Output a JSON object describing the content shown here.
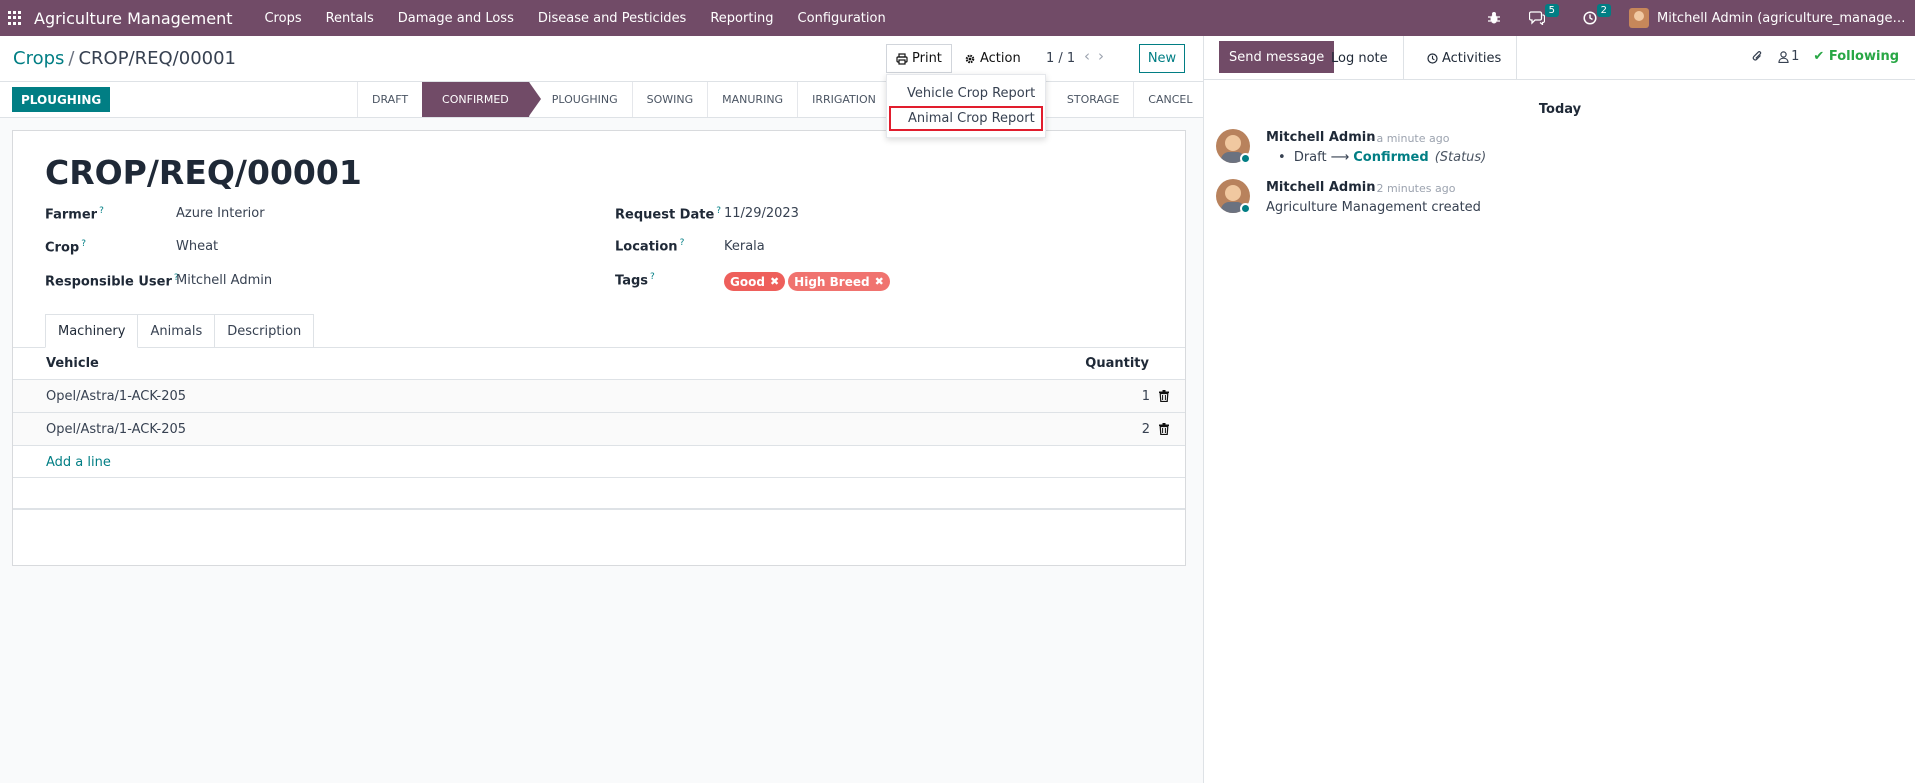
{
  "navbar": {
    "app_title": "Agriculture Management",
    "menu": [
      "Crops",
      "Rentals",
      "Damage and Loss",
      "Disease and Pesticides",
      "Reporting",
      "Configuration"
    ],
    "messages_count": "5",
    "activities_count": "2",
    "user": "Mitchell Admin (agriculture_management)"
  },
  "breadcrumb": {
    "parent": "Crops",
    "separator": "/",
    "current": "CROP/REQ/00001"
  },
  "control": {
    "print_label": "Print",
    "action_label": "Action",
    "pager": "1 / 1",
    "new_label": "New"
  },
  "print_menu": {
    "items": [
      "Vehicle Crop Report",
      "Animal Crop Report"
    ]
  },
  "status": {
    "action_button": "PLOUGHING",
    "stages": [
      "DRAFT",
      "CONFIRMED",
      "PLOUGHING",
      "SOWING",
      "MANURING",
      "IRRIGATION",
      "STORAGE",
      "CANCEL"
    ],
    "active_stage": "CONFIRMED"
  },
  "form": {
    "title": "CROP/REQ/00001",
    "farmer_label": "Farmer",
    "farmer": "Azure Interior",
    "crop_label": "Crop",
    "crop": "Wheat",
    "user_label": "Responsible User",
    "user": "Mitchell Admin",
    "request_date_label": "Request Date",
    "request_date": "11/29/2023",
    "location_label": "Location",
    "location": "Kerala",
    "tags_label": "Tags",
    "tags": [
      {
        "label": "Good",
        "color": "#ee5f5b"
      },
      {
        "label": "High Breed",
        "color": "#f0736f"
      }
    ],
    "help_mark": "?"
  },
  "tabs": [
    "Machinery",
    "Animals",
    "Description"
  ],
  "table": {
    "headers": {
      "vehicle": "Vehicle",
      "quantity": "Quantity"
    },
    "rows": [
      {
        "vehicle": "Opel/Astra/1-ACK-205",
        "quantity": "1"
      },
      {
        "vehicle": "Opel/Astra/1-ACK-205",
        "quantity": "2"
      }
    ],
    "add_line": "Add a line"
  },
  "chatter": {
    "send_message": "Send message",
    "log_note": "Log note",
    "activities": "Activities",
    "followers_count": "1",
    "following": "Following",
    "today": "Today",
    "messages": [
      {
        "author": "Mitchell Admin",
        "time": "- a minute ago",
        "old": "Draft",
        "new": "Confirmed",
        "field": "(Status)"
      },
      {
        "author": "Mitchell Admin",
        "time": "- 2 minutes ago",
        "body": "Agriculture Management created"
      }
    ]
  },
  "colors": {
    "brand": "#714b67",
    "accent": "#017e84",
    "following": "#28a745",
    "highlight": "#e11d2d"
  }
}
